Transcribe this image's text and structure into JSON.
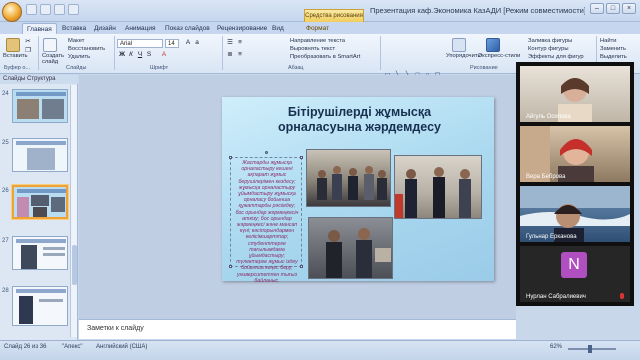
{
  "window": {
    "title": "Презентация  каф.Экономика КазАДИ [Режим совместимости] - Micr...",
    "context_tab": "Средства рисования",
    "controls": [
      "–",
      "□",
      "×"
    ]
  },
  "ribbon_tabs": [
    "Главная",
    "Вставка",
    "Дизайн",
    "Анимация",
    "Показ слайдов",
    "Рецензирование",
    "Вид",
    "Формат"
  ],
  "ribbon": {
    "clipboard": {
      "paste": "Вставить",
      "cut": "",
      "copy": "",
      "label": "Буфер о..."
    },
    "slides": {
      "new_slide": "Создать слайд",
      "layout": "Макет",
      "reset": "Восстановить",
      "delete": "Удалить",
      "label": "Слайды"
    },
    "font": {
      "name": "Arial",
      "size": "14",
      "label": "Шрифт"
    },
    "paragraph": {
      "direction": "Направление текста",
      "align": "Выровнять текст",
      "smartart": "Преобразовать в SmartArt",
      "label": "Абзац"
    },
    "drawing": {
      "arrange": "Упорядочить",
      "quick_styles": "Экспресс-стили",
      "fill": "Заливка фигуры",
      "outline": "Контур фигуры",
      "effects": "Эффекты для фигур",
      "label": "Рисование"
    },
    "editing": {
      "find": "Найти",
      "replace": "Заменить",
      "select": "Выделить",
      "label": "Редактирование"
    }
  },
  "slides_pane": {
    "tabs": "Слайды   Структура",
    "numbers": [
      "24",
      "25",
      "26",
      "27",
      "28"
    ]
  },
  "slide": {
    "title": "Бітірушілерді жұмысқа орналасуына жәрдемдесу",
    "body": "Жастарды жұмысқа орналастыру кешені ақпарат жұмыс берушілерімен кездесу; жұмысқа орналастыру ұйымдастыру жұмысқа орналасу бойынша құжаттарды рәсімдеу; бос орындар жәрмеңкесін өткізу; бос орындар жәрмеңкесі және мансап күні; кәсіпорындармен келісімшарттар; студенттерге тағылымдама ұйымдастыру; түлектерге жұмыс іздеу бойынша кеңес беру; университетпен тығыз байланыс."
  },
  "notes": {
    "placeholder": "Заметки к слайду"
  },
  "status_bar": {
    "slide_info": "Слайд 26 из 36",
    "theme": "\"Апекс\"",
    "language": "Английский (США)",
    "zoom": "62%"
  },
  "participants": [
    {
      "name": "Айгуль Осипова"
    },
    {
      "name": "Вера Беброва"
    },
    {
      "name": "Гульнар Ерканова"
    },
    {
      "name": "Нурлан Сабралиевич",
      "initial": "N"
    }
  ]
}
